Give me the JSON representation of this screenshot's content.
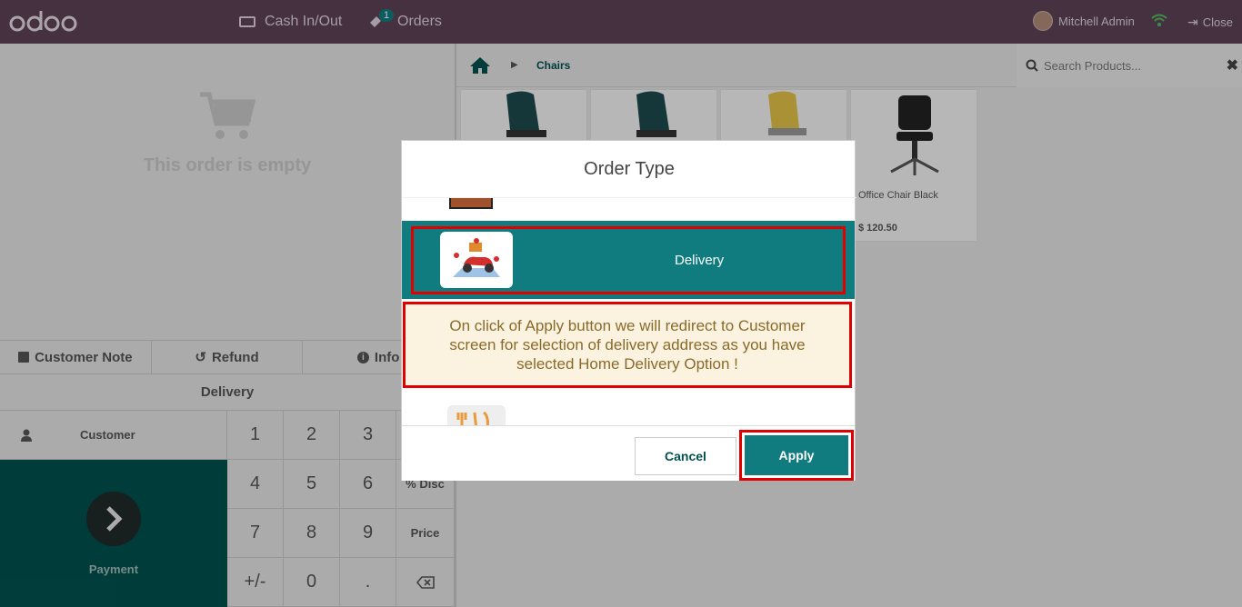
{
  "topbar": {
    "logo": "odoo",
    "cash_label": "Cash In/Out",
    "orders_label": "Orders",
    "orders_count": "1",
    "user_name": "Mitchell Admin",
    "close_label": "Close"
  },
  "order": {
    "empty_text": "This order is empty"
  },
  "controls": {
    "customer_note": "Customer Note",
    "refund": "Refund",
    "info": "Info",
    "order_type": "Delivery",
    "customer": "Customer",
    "payment": "Payment"
  },
  "numpad": [
    "1",
    "2",
    "3",
    "",
    "4",
    "5",
    "6",
    "% Disc",
    "7",
    "8",
    "9",
    "Price",
    "+/-",
    "0",
    ".",
    ""
  ],
  "catalog": {
    "breadcrumb": "Chairs",
    "search_placeholder": "Search Products...",
    "products": [
      {
        "name": "",
        "price": ""
      },
      {
        "name": "",
        "price": ""
      },
      {
        "name": "",
        "price": ""
      },
      {
        "name": "Office Chair Black",
        "price": "$ 120.50"
      }
    ]
  },
  "modal": {
    "title": "Order Type",
    "selected_option": "Delivery",
    "note": "On click of Apply button we will redirect to Customer screen for selection of delivery address as you have selected Home Delivery Option !",
    "cancel_label": "Cancel",
    "apply_label": "Apply"
  },
  "colors": {
    "topbar": "#5d4256",
    "accent": "#107c80",
    "payment": "#01514e",
    "highlight": "#e00000"
  }
}
